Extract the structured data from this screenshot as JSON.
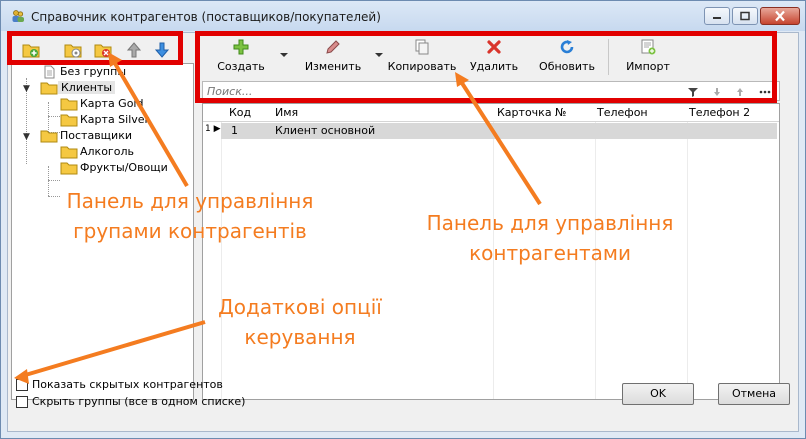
{
  "window": {
    "title": "Справочник контрагентов (поставщиков/покупателей)"
  },
  "left_toolbar": {
    "buttons": [
      {
        "icon": "folder-add-icon"
      },
      {
        "icon": "folder-edit-icon"
      },
      {
        "icon": "folder-delete-icon"
      },
      {
        "icon": "arrow-up-icon"
      },
      {
        "icon": "arrow-down-icon"
      }
    ]
  },
  "tree": {
    "items": [
      {
        "label": "Без группы"
      },
      {
        "label": "Клиенты"
      },
      {
        "label": "Карта Gold"
      },
      {
        "label": "Карта Silver"
      },
      {
        "label": "Поставщики"
      },
      {
        "label": "Алкоголь"
      },
      {
        "label": "Фрукты/Овощи"
      }
    ]
  },
  "toolbar": {
    "create": "Создать",
    "edit": "Изменить",
    "copy": "Копировать",
    "delete": "Удалить",
    "refresh": "Обновить",
    "import": "Импорт"
  },
  "search": {
    "placeholder": "Поиск..."
  },
  "table": {
    "columns": [
      "Код",
      "Имя",
      "Карточка №",
      "Телефон",
      "Телефон 2"
    ],
    "rows": [
      {
        "indicator": "1 ▶",
        "code": "1",
        "name": "Клиент основной",
        "card": "",
        "phone": "",
        "phone2": ""
      }
    ]
  },
  "footer": {
    "show_hidden": "Показать скрытых контрагентов",
    "hide_groups": "Скрыть группы (все в одном списке)",
    "ok": "OK",
    "cancel": "Отмена"
  },
  "annotations": {
    "groups_panel": [
      "Панель для управління",
      "групами контрагентів"
    ],
    "counterparties_panel": [
      "Панель для управління",
      "контрагентами"
    ],
    "extra_options": [
      "Додаткові опції",
      "керування"
    ]
  },
  "colors": {
    "highlight": "#e10000",
    "annotation": "#f47c20"
  }
}
